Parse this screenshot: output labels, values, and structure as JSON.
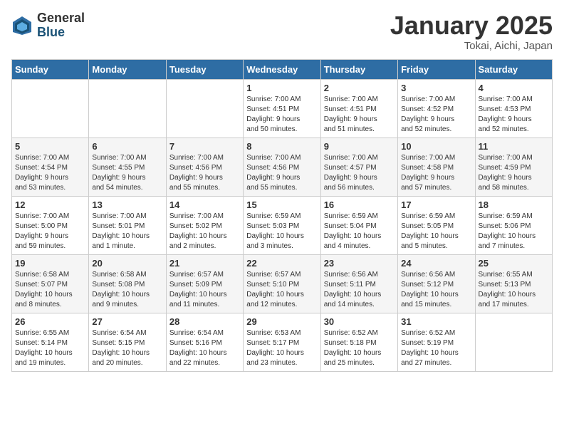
{
  "header": {
    "logo_general": "General",
    "logo_blue": "Blue",
    "title": "January 2025",
    "subtitle": "Tokai, Aichi, Japan"
  },
  "weekdays": [
    "Sunday",
    "Monday",
    "Tuesday",
    "Wednesday",
    "Thursday",
    "Friday",
    "Saturday"
  ],
  "weeks": [
    [
      {
        "day": "",
        "info": ""
      },
      {
        "day": "",
        "info": ""
      },
      {
        "day": "",
        "info": ""
      },
      {
        "day": "1",
        "info": "Sunrise: 7:00 AM\nSunset: 4:51 PM\nDaylight: 9 hours\nand 50 minutes."
      },
      {
        "day": "2",
        "info": "Sunrise: 7:00 AM\nSunset: 4:51 PM\nDaylight: 9 hours\nand 51 minutes."
      },
      {
        "day": "3",
        "info": "Sunrise: 7:00 AM\nSunset: 4:52 PM\nDaylight: 9 hours\nand 52 minutes."
      },
      {
        "day": "4",
        "info": "Sunrise: 7:00 AM\nSunset: 4:53 PM\nDaylight: 9 hours\nand 52 minutes."
      }
    ],
    [
      {
        "day": "5",
        "info": "Sunrise: 7:00 AM\nSunset: 4:54 PM\nDaylight: 9 hours\nand 53 minutes."
      },
      {
        "day": "6",
        "info": "Sunrise: 7:00 AM\nSunset: 4:55 PM\nDaylight: 9 hours\nand 54 minutes."
      },
      {
        "day": "7",
        "info": "Sunrise: 7:00 AM\nSunset: 4:56 PM\nDaylight: 9 hours\nand 55 minutes."
      },
      {
        "day": "8",
        "info": "Sunrise: 7:00 AM\nSunset: 4:56 PM\nDaylight: 9 hours\nand 55 minutes."
      },
      {
        "day": "9",
        "info": "Sunrise: 7:00 AM\nSunset: 4:57 PM\nDaylight: 9 hours\nand 56 minutes."
      },
      {
        "day": "10",
        "info": "Sunrise: 7:00 AM\nSunset: 4:58 PM\nDaylight: 9 hours\nand 57 minutes."
      },
      {
        "day": "11",
        "info": "Sunrise: 7:00 AM\nSunset: 4:59 PM\nDaylight: 9 hours\nand 58 minutes."
      }
    ],
    [
      {
        "day": "12",
        "info": "Sunrise: 7:00 AM\nSunset: 5:00 PM\nDaylight: 9 hours\nand 59 minutes."
      },
      {
        "day": "13",
        "info": "Sunrise: 7:00 AM\nSunset: 5:01 PM\nDaylight: 10 hours\nand 1 minute."
      },
      {
        "day": "14",
        "info": "Sunrise: 7:00 AM\nSunset: 5:02 PM\nDaylight: 10 hours\nand 2 minutes."
      },
      {
        "day": "15",
        "info": "Sunrise: 6:59 AM\nSunset: 5:03 PM\nDaylight: 10 hours\nand 3 minutes."
      },
      {
        "day": "16",
        "info": "Sunrise: 6:59 AM\nSunset: 5:04 PM\nDaylight: 10 hours\nand 4 minutes."
      },
      {
        "day": "17",
        "info": "Sunrise: 6:59 AM\nSunset: 5:05 PM\nDaylight: 10 hours\nand 5 minutes."
      },
      {
        "day": "18",
        "info": "Sunrise: 6:59 AM\nSunset: 5:06 PM\nDaylight: 10 hours\nand 7 minutes."
      }
    ],
    [
      {
        "day": "19",
        "info": "Sunrise: 6:58 AM\nSunset: 5:07 PM\nDaylight: 10 hours\nand 8 minutes."
      },
      {
        "day": "20",
        "info": "Sunrise: 6:58 AM\nSunset: 5:08 PM\nDaylight: 10 hours\nand 9 minutes."
      },
      {
        "day": "21",
        "info": "Sunrise: 6:57 AM\nSunset: 5:09 PM\nDaylight: 10 hours\nand 11 minutes."
      },
      {
        "day": "22",
        "info": "Sunrise: 6:57 AM\nSunset: 5:10 PM\nDaylight: 10 hours\nand 12 minutes."
      },
      {
        "day": "23",
        "info": "Sunrise: 6:56 AM\nSunset: 5:11 PM\nDaylight: 10 hours\nand 14 minutes."
      },
      {
        "day": "24",
        "info": "Sunrise: 6:56 AM\nSunset: 5:12 PM\nDaylight: 10 hours\nand 15 minutes."
      },
      {
        "day": "25",
        "info": "Sunrise: 6:55 AM\nSunset: 5:13 PM\nDaylight: 10 hours\nand 17 minutes."
      }
    ],
    [
      {
        "day": "26",
        "info": "Sunrise: 6:55 AM\nSunset: 5:14 PM\nDaylight: 10 hours\nand 19 minutes."
      },
      {
        "day": "27",
        "info": "Sunrise: 6:54 AM\nSunset: 5:15 PM\nDaylight: 10 hours\nand 20 minutes."
      },
      {
        "day": "28",
        "info": "Sunrise: 6:54 AM\nSunset: 5:16 PM\nDaylight: 10 hours\nand 22 minutes."
      },
      {
        "day": "29",
        "info": "Sunrise: 6:53 AM\nSunset: 5:17 PM\nDaylight: 10 hours\nand 23 minutes."
      },
      {
        "day": "30",
        "info": "Sunrise: 6:52 AM\nSunset: 5:18 PM\nDaylight: 10 hours\nand 25 minutes."
      },
      {
        "day": "31",
        "info": "Sunrise: 6:52 AM\nSunset: 5:19 PM\nDaylight: 10 hours\nand 27 minutes."
      },
      {
        "day": "",
        "info": ""
      }
    ]
  ]
}
